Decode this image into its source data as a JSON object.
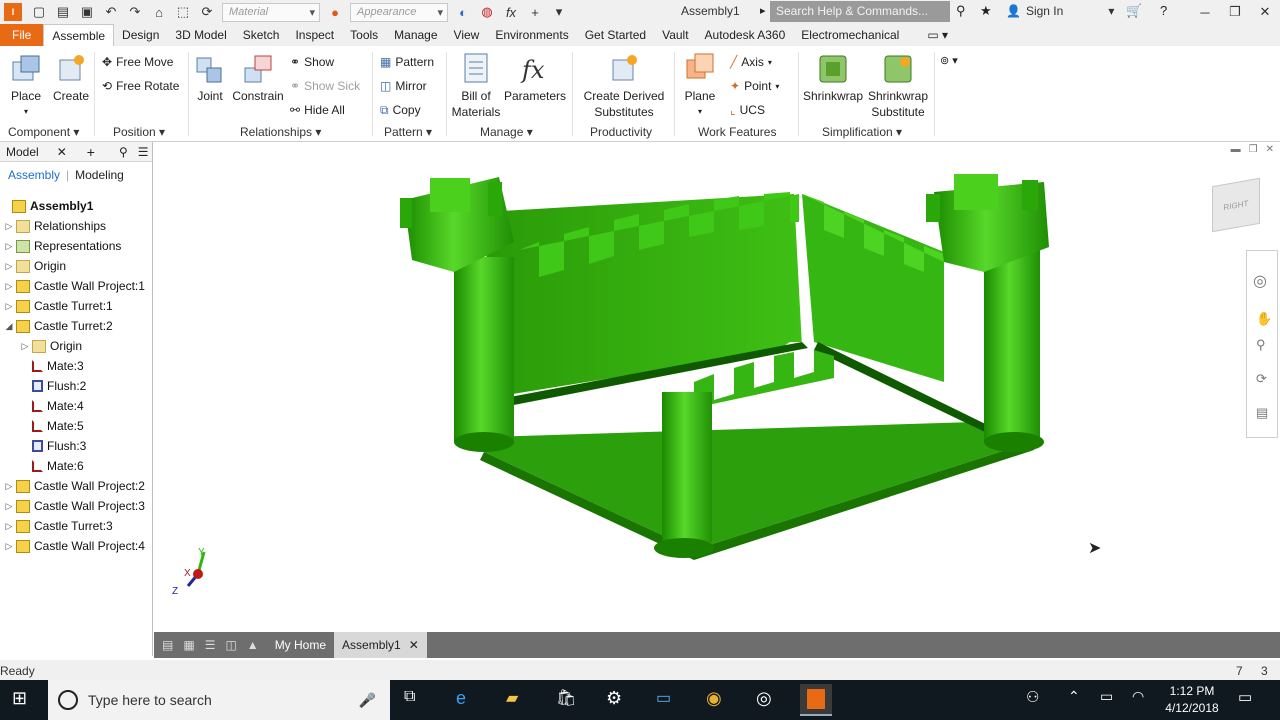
{
  "titlebar": {
    "material_placeholder": "Material",
    "appearance_placeholder": "Appearance",
    "document_title": "Assembly1",
    "search_placeholder": "Search Help & Commands...",
    "sign_in": "Sign In"
  },
  "ribbon_tabs": [
    "File",
    "Assemble",
    "Design",
    "3D Model",
    "Sketch",
    "Inspect",
    "Tools",
    "Manage",
    "View",
    "Environments",
    "Get Started",
    "Vault",
    "Autodesk A360",
    "Electromechanical"
  ],
  "ribbon": {
    "component": {
      "place": "Place",
      "create": "Create",
      "label": "Component"
    },
    "position": {
      "free_move": "Free Move",
      "free_rotate": "Free Rotate",
      "label": "Position"
    },
    "relationships": {
      "joint": "Joint",
      "constrain": "Constrain",
      "show": "Show",
      "show_sick": "Show Sick",
      "hide_all": "Hide All",
      "label": "Relationships"
    },
    "pattern": {
      "pattern": "Pattern",
      "mirror": "Mirror",
      "copy": "Copy",
      "label": "Pattern"
    },
    "manage": {
      "bom_line1": "Bill of",
      "bom_line2": "Materials",
      "parameters": "Parameters",
      "label": "Manage"
    },
    "productivity": {
      "line1": "Create Derived",
      "line2": "Substitutes",
      "label": "Productivity"
    },
    "work_features": {
      "plane": "Plane",
      "axis": "Axis",
      "point": "Point",
      "ucs": "UCS",
      "label": "Work Features"
    },
    "simplification": {
      "shrinkwrap": "Shrinkwrap",
      "sub_line1": "Shrinkwrap",
      "sub_line2": "Substitute",
      "label": "Simplification"
    }
  },
  "browser": {
    "title": "Model",
    "tab_assembly": "Assembly",
    "tab_modeling": "Modeling",
    "tree": [
      {
        "label": "Assembly1",
        "icon": "assembly-icon"
      },
      {
        "label": "Relationships",
        "icon": "folder-icon"
      },
      {
        "label": "Representations",
        "icon": "representations-icon"
      },
      {
        "label": "Origin",
        "icon": "folder-icon"
      },
      {
        "label": "Castle Wall Project:1",
        "icon": "part-icon"
      },
      {
        "label": "Castle Turret:1",
        "icon": "part-icon"
      },
      {
        "label": "Castle Turret:2",
        "icon": "part-icon"
      },
      {
        "label": "Origin",
        "icon": "folder-icon"
      },
      {
        "label": "Mate:3",
        "icon": "mate-icon"
      },
      {
        "label": "Flush:2",
        "icon": "flush-icon"
      },
      {
        "label": "Mate:4",
        "icon": "mate-icon"
      },
      {
        "label": "Mate:5",
        "icon": "mate-icon"
      },
      {
        "label": "Flush:3",
        "icon": "flush-icon"
      },
      {
        "label": "Mate:6",
        "icon": "mate-icon"
      },
      {
        "label": "Castle Wall Project:2",
        "icon": "part-icon"
      },
      {
        "label": "Castle Wall Project:3",
        "icon": "part-icon"
      },
      {
        "label": "Castle Turret:3",
        "icon": "part-icon"
      },
      {
        "label": "Castle Wall Project:4",
        "icon": "part-icon"
      }
    ]
  },
  "viewcube": {
    "face": "RIGHT"
  },
  "triad": {
    "x": "X",
    "y": "Y",
    "z": "Z"
  },
  "doc_tabs": {
    "home": "My Home",
    "assembly": "Assembly1"
  },
  "status": {
    "text": "Ready",
    "count_a": "7",
    "count_b": "3"
  },
  "taskbar": {
    "search_placeholder": "Type here to search",
    "time": "1:12 PM",
    "date": "4/12/2018"
  },
  "colors": {
    "accent_file": "#e86a14",
    "model_green": "#2fb80a",
    "taskbar": "#101820"
  }
}
